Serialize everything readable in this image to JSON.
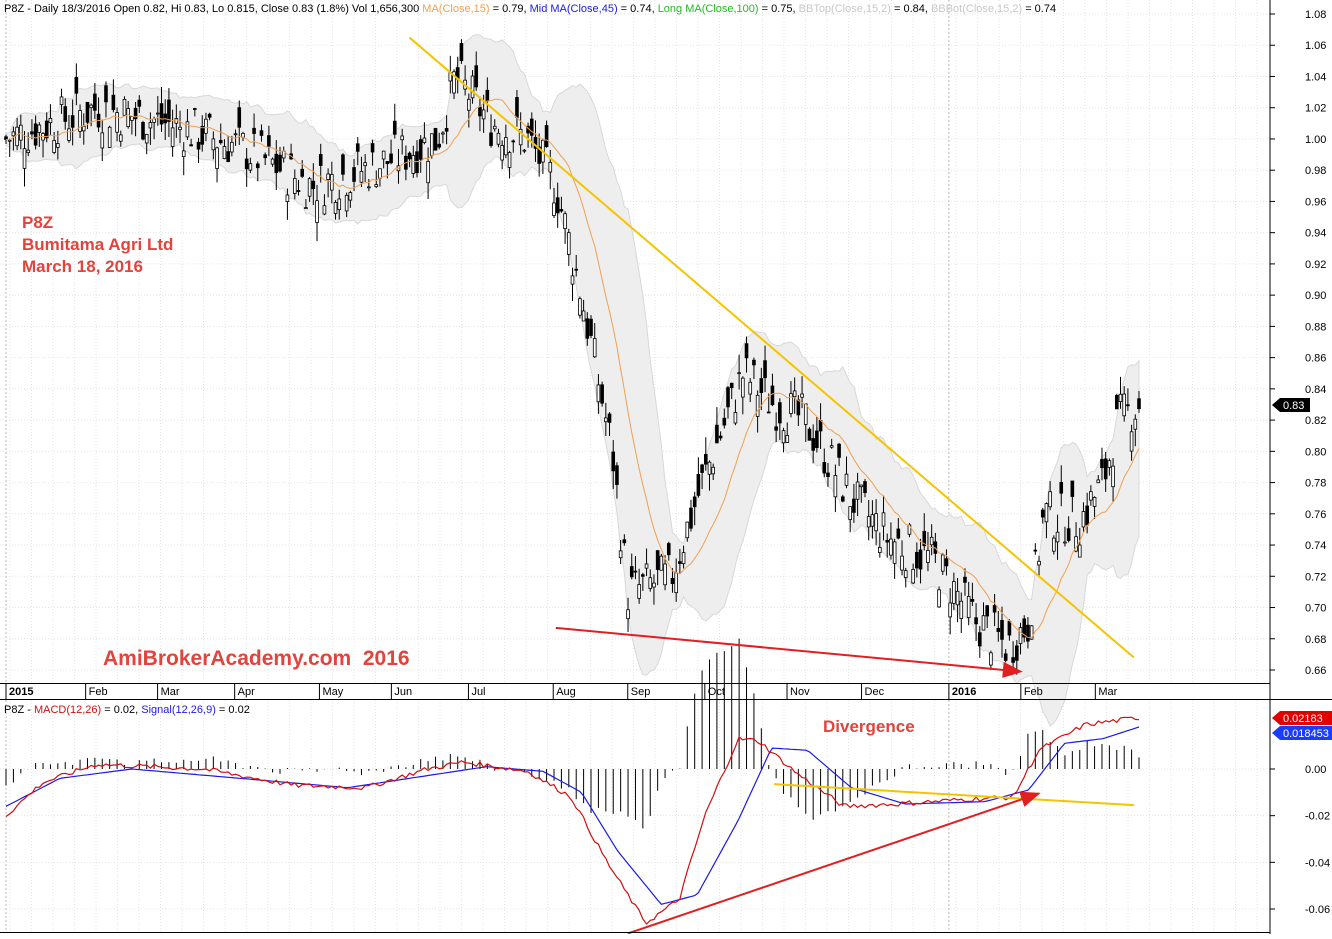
{
  "header": {
    "price": [
      {
        "text": "P8Z - Daily 18/3/2016 Open 0.82, Hi 0.83, Lo 0.815, Close 0.83 (1.8%) Vol 1,656,300 ",
        "color": "#000000"
      },
      {
        "text": "MA(Close,15)",
        "color": "#f0a050"
      },
      {
        "text": " = 0.79, ",
        "color": "#000000"
      },
      {
        "text": "Mid MA(Close,45)",
        "color": "#1a1ae6"
      },
      {
        "text": " = 0.74, ",
        "color": "#000000"
      },
      {
        "text": "Long MA(Close,100)",
        "color": "#22bb22"
      },
      {
        "text": " = 0.75, ",
        "color": "#000000"
      },
      {
        "text": "BBTop(Close,15,2)",
        "color": "#c8c8c8"
      },
      {
        "text": " = 0.84, ",
        "color": "#000000"
      },
      {
        "text": "BBBot(Close,15,2)",
        "color": "#c8c8c8"
      },
      {
        "text": " = 0.74",
        "color": "#000000"
      }
    ],
    "macd": [
      {
        "text": "P8Z - ",
        "color": "#000000"
      },
      {
        "text": "MACD(12,26)",
        "color": "#d01010"
      },
      {
        "text": " = 0.02, ",
        "color": "#000000"
      },
      {
        "text": "Signal(12,26,9)",
        "color": "#1a1ae6"
      },
      {
        "text": " = 0.02",
        "color": "#000000"
      }
    ]
  },
  "annotations": {
    "symbol": "P8Z",
    "company": "Bumitama Agri Ltd",
    "date": "March 18, 2016",
    "watermark": "AmiBrokerAcademy.com  2016",
    "divergence": "Divergence"
  },
  "colors": {
    "candle": "#000000",
    "band": "#d8d8d8",
    "ma15": "#f0a050",
    "trendline": "#f5c400",
    "divergence_arrow": "#e02020",
    "macd": "#d01010",
    "signal": "#1a1ae6",
    "histogram": "#000000"
  },
  "chart_data": [
    {
      "type": "candlestick",
      "symbol": "P8Z",
      "x_ticks": [
        "2015",
        "Feb",
        "Mar",
        "Apr",
        "May",
        "Jun",
        "Jul",
        "Aug",
        "Sep",
        "Oct",
        "Nov",
        "Dec",
        "2016",
        "Feb",
        "Mar"
      ],
      "y_ticks": [
        "1.08",
        "1.06",
        "1.04",
        "1.02",
        "1.00",
        "0.98",
        "0.96",
        "0.94",
        "0.92",
        "0.90",
        "0.88",
        "0.86",
        "0.84",
        "0.82",
        "0.80",
        "0.78",
        "0.76",
        "0.74",
        "0.72",
        "0.70",
        "0.68",
        "0.66"
      ],
      "ylim": [
        0.652,
        1.088
      ],
      "last_close_label": "0.83",
      "close_anchors": [
        {
          "date": "2015-01-02",
          "close": 1.0
        },
        {
          "date": "2015-02-06",
          "close": 1.02
        },
        {
          "date": "2015-03-06",
          "close": 1.01
        },
        {
          "date": "2015-04-03",
          "close": 0.995
        },
        {
          "date": "2015-05-01",
          "close": 0.97
        },
        {
          "date": "2015-05-29",
          "close": 0.985
        },
        {
          "date": "2015-06-19",
          "close": 1.0
        },
        {
          "date": "2015-06-26",
          "close": 1.04
        },
        {
          "date": "2015-07-10",
          "close": 1.01
        },
        {
          "date": "2015-07-24",
          "close": 1.0
        },
        {
          "date": "2015-08-04",
          "close": 0.97
        },
        {
          "date": "2015-08-14",
          "close": 0.9
        },
        {
          "date": "2015-08-26",
          "close": 0.8
        },
        {
          "date": "2015-09-01",
          "close": 0.71
        },
        {
          "date": "2015-09-18",
          "close": 0.72
        },
        {
          "date": "2015-09-30",
          "close": 0.78
        },
        {
          "date": "2015-10-16",
          "close": 0.85
        },
        {
          "date": "2015-10-28",
          "close": 0.83
        },
        {
          "date": "2015-11-09",
          "close": 0.82
        },
        {
          "date": "2015-11-27",
          "close": 0.77
        },
        {
          "date": "2015-12-11",
          "close": 0.745
        },
        {
          "date": "2015-12-29",
          "close": 0.73
        },
        {
          "date": "2016-01-15",
          "close": 0.69
        },
        {
          "date": "2016-01-27",
          "close": 0.675
        },
        {
          "date": "2016-02-04",
          "close": 0.69
        },
        {
          "date": "2016-02-10",
          "close": 0.76
        },
        {
          "date": "2016-02-24",
          "close": 0.755
        },
        {
          "date": "2016-03-04",
          "close": 0.78
        },
        {
          "date": "2016-03-10",
          "close": 0.82
        },
        {
          "date": "2016-03-18",
          "close": 0.83
        }
      ],
      "trendline": {
        "start": {
          "date": "2015-06-08",
          "value": 1.065
        },
        "end": {
          "date": "2016-03-16",
          "value": 0.668
        }
      },
      "divergence_line": {
        "start": {
          "date": "2015-08-04",
          "value": 0.687
        },
        "end": {
          "date": "2016-02-01",
          "value": 0.659
        }
      }
    },
    {
      "type": "line",
      "indicator": "MACD",
      "x_ticks": [
        "2015",
        "Feb",
        "Mar",
        "Apr",
        "May",
        "Jun",
        "Jul",
        "Aug",
        "Sep",
        "Oct",
        "Nov",
        "Dec",
        "2016",
        "Feb",
        "Mar"
      ],
      "y_ticks": [
        "0.00",
        "-0.02",
        "-0.04",
        "-0.06"
      ],
      "ylim": [
        -0.0705,
        0.0255
      ],
      "macd_label": "0.02183",
      "signal_label": "0.018453",
      "macd_anchors": [
        {
          "date": "2015-01-02",
          "value": -0.02
        },
        {
          "date": "2015-01-16",
          "value": -0.006
        },
        {
          "date": "2015-02-06",
          "value": 0.002
        },
        {
          "date": "2015-03-20",
          "value": 0.0
        },
        {
          "date": "2015-04-24",
          "value": -0.007
        },
        {
          "date": "2015-05-22",
          "value": -0.008
        },
        {
          "date": "2015-06-15",
          "value": 0.0
        },
        {
          "date": "2015-06-29",
          "value": 0.003
        },
        {
          "date": "2015-07-24",
          "value": -0.001
        },
        {
          "date": "2015-08-10",
          "value": -0.012
        },
        {
          "date": "2015-08-24",
          "value": -0.04
        },
        {
          "date": "2015-09-08",
          "value": -0.066
        },
        {
          "date": "2015-09-21",
          "value": -0.056
        },
        {
          "date": "2015-10-01",
          "value": -0.02
        },
        {
          "date": "2015-10-14",
          "value": 0.013
        },
        {
          "date": "2015-10-22",
          "value": 0.012
        },
        {
          "date": "2015-11-06",
          "value": -0.002
        },
        {
          "date": "2015-11-24",
          "value": -0.016
        },
        {
          "date": "2015-12-14",
          "value": -0.015
        },
        {
          "date": "2016-01-11",
          "value": -0.013
        },
        {
          "date": "2016-01-29",
          "value": -0.012
        },
        {
          "date": "2016-02-08",
          "value": 0.008
        },
        {
          "date": "2016-02-26",
          "value": 0.019
        },
        {
          "date": "2016-03-18",
          "value": 0.022
        }
      ],
      "signal_anchors": [
        {
          "date": "2015-01-02",
          "value": -0.016
        },
        {
          "date": "2015-01-23",
          "value": -0.004
        },
        {
          "date": "2015-02-20",
          "value": 0.0
        },
        {
          "date": "2015-04-03",
          "value": -0.004
        },
        {
          "date": "2015-05-15",
          "value": -0.008
        },
        {
          "date": "2015-06-08",
          "value": -0.004
        },
        {
          "date": "2015-07-08",
          "value": 0.001
        },
        {
          "date": "2015-07-30",
          "value": -0.001
        },
        {
          "date": "2015-08-14",
          "value": -0.01
        },
        {
          "date": "2015-08-28",
          "value": -0.035
        },
        {
          "date": "2015-09-14",
          "value": -0.058
        },
        {
          "date": "2015-09-28",
          "value": -0.054
        },
        {
          "date": "2015-10-14",
          "value": -0.022
        },
        {
          "date": "2015-10-27",
          "value": 0.009
        },
        {
          "date": "2015-11-10",
          "value": 0.008
        },
        {
          "date": "2015-11-27",
          "value": -0.008
        },
        {
          "date": "2015-12-18",
          "value": -0.015
        },
        {
          "date": "2016-01-18",
          "value": -0.014
        },
        {
          "date": "2016-02-04",
          "value": -0.009
        },
        {
          "date": "2016-02-18",
          "value": 0.011
        },
        {
          "date": "2016-03-04",
          "value": 0.013
        },
        {
          "date": "2016-03-18",
          "value": 0.018
        }
      ],
      "trendline": {
        "start": {
          "date": "2015-10-28",
          "value": -0.0065
        },
        "end": {
          "date": "2016-03-16",
          "value": -0.0155
        }
      },
      "divergence_line": {
        "start": {
          "date": "2015-09-01",
          "value": -0.0705
        },
        "end": {
          "date": "2016-02-08",
          "value": -0.0105
        }
      }
    }
  ]
}
